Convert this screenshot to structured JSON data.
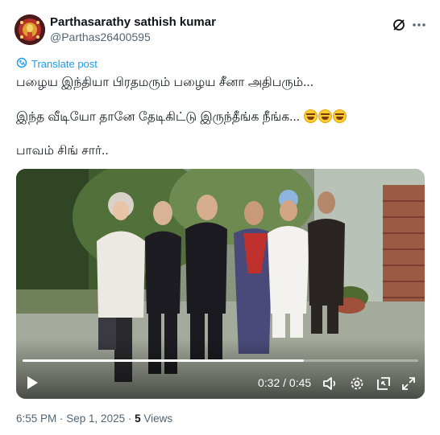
{
  "author": {
    "name": "Parthasarathy sathish kumar",
    "handle": "@Parthas26400595"
  },
  "icons": {
    "grok": "grok-icon",
    "more": "more-dots-icon",
    "translate": "globe-translate-icon",
    "play": "play-icon",
    "volume": "volume-icon",
    "settings": "gear-icon",
    "pip": "picture-in-picture-icon",
    "fullscreen": "fullscreen-icon"
  },
  "translate_label": "Translate post",
  "post": {
    "line1": "பழைய இந்தியா பிரதமரும் பழைய சீனா அதிபரும்...",
    "line2": "இந்த வீடியோ தானே தேடிகிட்டு இருந்தீங்க நீங்க...",
    "line3": "பாவம் சிங் சார்..",
    "emoji_count": 3
  },
  "video": {
    "current_time": "0:32",
    "duration": "0:45",
    "time_separator": " / ",
    "progress": 0.711
  },
  "meta": {
    "time": "6:55 PM",
    "date": "Sep 1, 2025",
    "separator": " · ",
    "views_count": "5",
    "views_label": "Views"
  },
  "colors": {
    "link": "#1d9bf0",
    "secondary_text": "#536471",
    "primary_text": "#0f1419"
  }
}
